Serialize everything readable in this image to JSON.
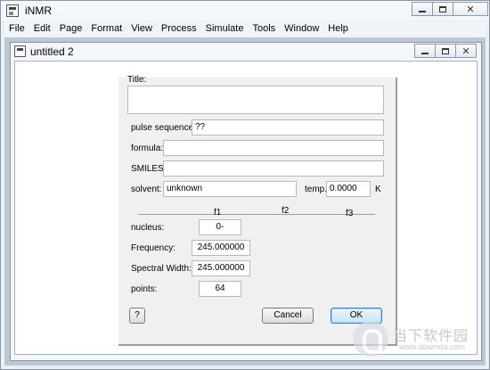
{
  "app": {
    "title": "iNMR"
  },
  "menubar": [
    "File",
    "Edit",
    "Page",
    "Format",
    "View",
    "Process",
    "Simulate",
    "Tools",
    "Window",
    "Help"
  ],
  "document": {
    "title": "untitled 2"
  },
  "dialog": {
    "title_label": "Title:",
    "title_value": "",
    "pulse_sequence_label": "pulse sequence:",
    "pulse_sequence_value": "??",
    "formula_label": "formula:",
    "formula_value": "",
    "smiles_label": "SMILES:",
    "smiles_value": "",
    "solvent_label": "solvent:",
    "solvent_value": "unknown",
    "temp_label": "temp.",
    "temp_value": "0.0000",
    "temp_unit": "K",
    "columns": [
      "f1",
      "f2",
      "f3"
    ],
    "nucleus_label": "nucleus:",
    "nucleus_value": "0-",
    "frequency_label": "Frequency:",
    "frequency_value": "245.000000",
    "spectral_width_label": "Spectral Width:",
    "spectral_width_value": "245.000000",
    "points_label": "points:",
    "points_value": "64",
    "help_button": "?",
    "cancel_button": "Cancel",
    "ok_button": "OK"
  },
  "watermark": {
    "text": "当下软件园",
    "url": "www.downxia.com"
  }
}
